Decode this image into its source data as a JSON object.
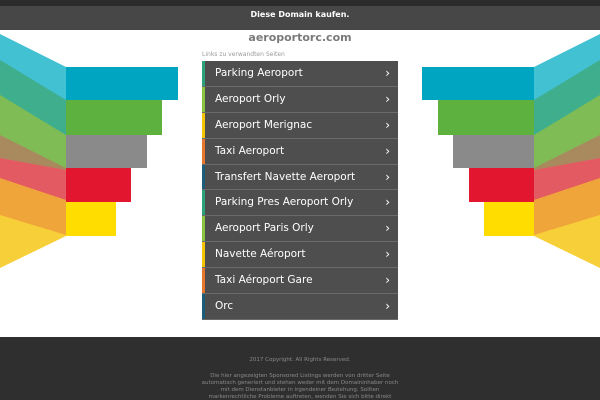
{
  "topbar": {
    "buy_domain_label": "Diese Domain kaufen."
  },
  "header": {
    "domain": "aeroportorc.com"
  },
  "related": {
    "title": "Links zu verwandten Seiten",
    "chevron": "›",
    "items": [
      {
        "label": "Parking Aeroport",
        "accent": "#2aa37a"
      },
      {
        "label": "Aeroport Orly",
        "accent": "#8ac43f"
      },
      {
        "label": "Aeroport Merignac",
        "accent": "#f2c500"
      },
      {
        "label": "Taxi Aeroport",
        "accent": "#e8772e"
      },
      {
        "label": "Transfert Navette Aeroport",
        "accent": "#1c5d7a"
      },
      {
        "label": "Parking Pres Aeroport Orly",
        "accent": "#2aa37a"
      },
      {
        "label": "Aeroport Paris Orly",
        "accent": "#8ac43f"
      },
      {
        "label": "Navette Aéroport",
        "accent": "#f2c500"
      },
      {
        "label": "Taxi Aéroport Gare",
        "accent": "#e8772e"
      },
      {
        "label": "Orc",
        "accent": "#1c5d7a"
      }
    ]
  },
  "footer": {
    "copyright": "2017 Copyright. All Rights Reserved.",
    "disclaimer": "Die hier angezeigten Sponsored Listings werden von dritter Seite automatisch generiert und stehen weder mit dem Domaininhaber noch mit dem Dienstanbieter in irgendeiner Beziehung. Sollten markenrechtliche Probleme auftreten, wenden Sie sich bitte direkt"
  },
  "colors": {
    "band_teal": "#00a5c2",
    "band_green": "#5db13e",
    "band_gray": "#8a8a8a",
    "band_red": "#e3162f",
    "band_yellow": "#ffdd00"
  }
}
